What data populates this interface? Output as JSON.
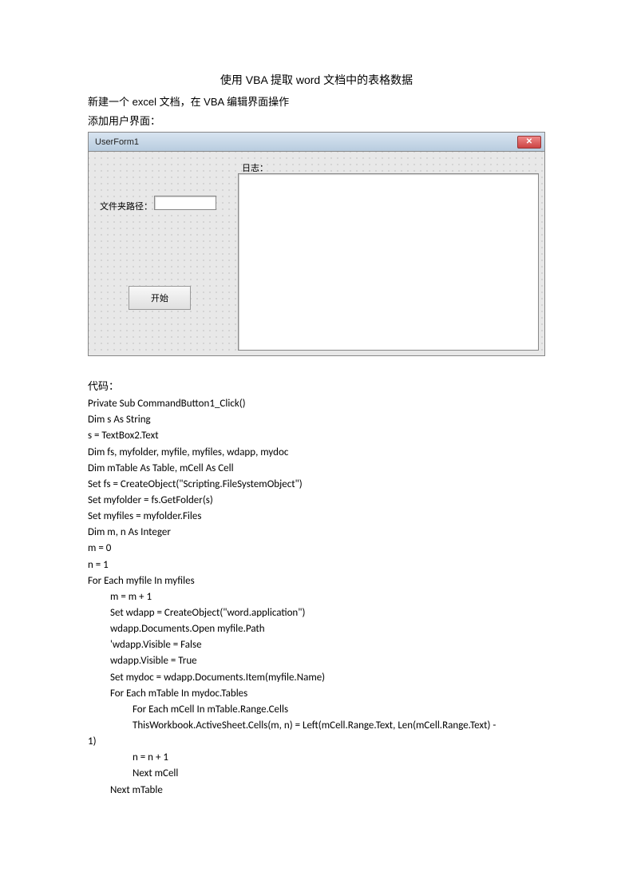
{
  "title": "使用 VBA 提取 word 文档中的表格数据",
  "intro1": "新建一个 excel 文档，在 VBA 编辑界面操作",
  "intro2": "添加用户界面：",
  "form": {
    "titlebar": "UserForm1",
    "logLabel": "日志：",
    "pathLabel": "文件夹路径：",
    "startButton": "开始"
  },
  "codeLabel": "代码：",
  "code": {
    "l1": "Private Sub CommandButton1_Click()",
    "l2": "Dim s As String",
    "l3": "s = TextBox2.Text",
    "l4": "Dim fs, myfolder, myfile, myfiles, wdapp, mydoc",
    "l5": "Dim mTable As Table, mCell As Cell",
    "l6": "Set fs = CreateObject(\"Scripting.FileSystemObject\")",
    "l7": "Set myfolder = fs.GetFolder(s)",
    "l8": "Set myfiles = myfolder.Files",
    "l9": "Dim m, n As Integer",
    "l10": "m = 0",
    "l11": "n = 1",
    "l12": "For Each myfile In myfiles",
    "l13": "m = m + 1",
    "l14": "Set wdapp = CreateObject(\"word.application\")",
    "l15": "wdapp.Documents.Open myfile.Path",
    "l16": "'wdapp.Visible = False",
    "l17": "wdapp.Visible = True",
    "l18": "Set mydoc = wdapp.Documents.Item(myfile.Name)",
    "l19": "For Each mTable In mydoc.Tables",
    "l20": "For Each mCell In mTable.Range.Cells",
    "l21a": "ThisWorkbook.ActiveSheet.Cells(m, n) = Left(mCell.Range.Text, Len(mCell.Range.Text) -",
    "l21b": "1)",
    "l22": "n = n + 1",
    "l23": "Next mCell",
    "l24": "Next mTable"
  }
}
